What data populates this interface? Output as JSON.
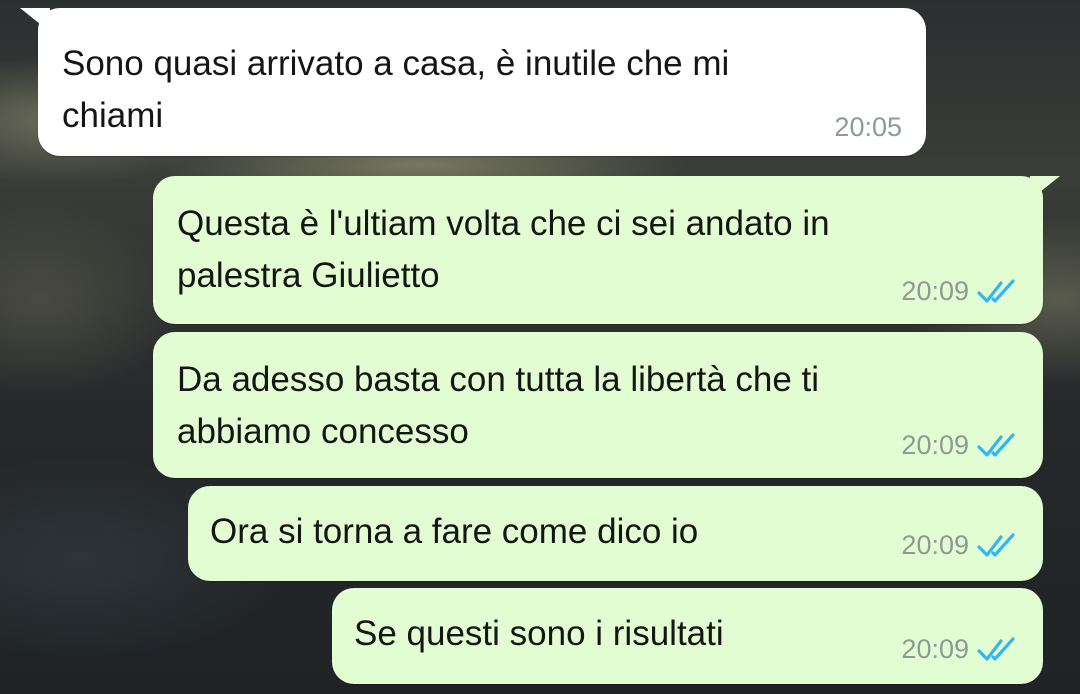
{
  "colors": {
    "incoming_bubble": "#ffffff",
    "outgoing_bubble": "#e2fdd2",
    "read_ticks": "#34b7f1",
    "timestamp": "#8d9a96"
  },
  "messages": [
    {
      "direction": "incoming",
      "text": "Sono quasi arrivato a casa, è inutile che mi\nchiami",
      "time": "20:05"
    },
    {
      "direction": "outgoing",
      "text": "Questa è l'ultiam volta che ci sei andato in\npalestra Giulietto",
      "time": "20:09",
      "status_icon": "double-check-icon"
    },
    {
      "direction": "outgoing",
      "text": "Da adesso basta con tutta la libertà che ti\nabbiamo concesso",
      "time": "20:09",
      "status_icon": "double-check-icon"
    },
    {
      "direction": "outgoing",
      "text": "Ora si torna a fare come dico io",
      "time": "20:09",
      "status_icon": "double-check-icon"
    },
    {
      "direction": "outgoing",
      "text": "Se questi sono i risultati",
      "time": "20:09",
      "status_icon": "double-check-icon"
    }
  ]
}
